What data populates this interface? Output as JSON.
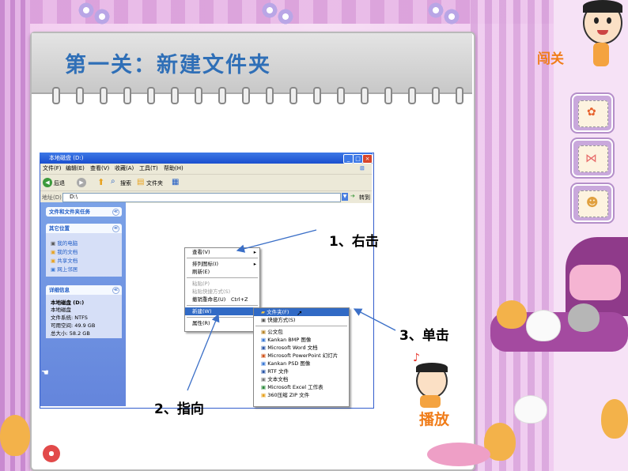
{
  "slide": {
    "title": "第一关：新建文件夹",
    "right_top_label": "闯关",
    "play_label": "播放"
  },
  "window": {
    "title": "本地磁盘 (D:)",
    "menu": [
      "文件(F)",
      "编辑(E)",
      "查看(V)",
      "收藏(A)",
      "工具(T)",
      "帮助(H)"
    ],
    "toolbar": {
      "back": "后退",
      "search": "搜索",
      "folders": "文件夹"
    },
    "address": {
      "label": "地址(D)",
      "value": "D:\\",
      "go": "转到"
    },
    "left_panel": {
      "tasks_title": "文件和文件夹任务",
      "places_title": "其它位置",
      "places": [
        "我的电脑",
        "我的文档",
        "共享文档",
        "网上邻居"
      ],
      "details_title": "详细信息",
      "details": [
        "本地磁盘 (D:)",
        "本地磁盘",
        "文件系统: NTFS",
        "可用空间: 49.9 GB",
        "总大小: 58.2 GB"
      ]
    }
  },
  "context_menu": {
    "items": [
      "查看(V)",
      "排列图标(I)",
      "刷新(E)",
      "粘贴(P)",
      "粘贴快捷方式(S)",
      "撤销重命名(U)",
      "新建(W)",
      "属性(R)"
    ],
    "undo_shortcut": "Ctrl+Z"
  },
  "submenu": {
    "items": [
      "文件夹(F)",
      "快捷方式(S)",
      "公文包",
      "Kankan BMP 图像",
      "Microsoft Word 文档",
      "Microsoft PowerPoint 幻灯片",
      "Kankan PSD 图像",
      "RTF 文件",
      "文本文档",
      "Microsoft Excel 工作表",
      "360压缩 ZIP 文件"
    ]
  },
  "annotations": [
    "1、右击",
    "2、指向",
    "3、单击"
  ]
}
